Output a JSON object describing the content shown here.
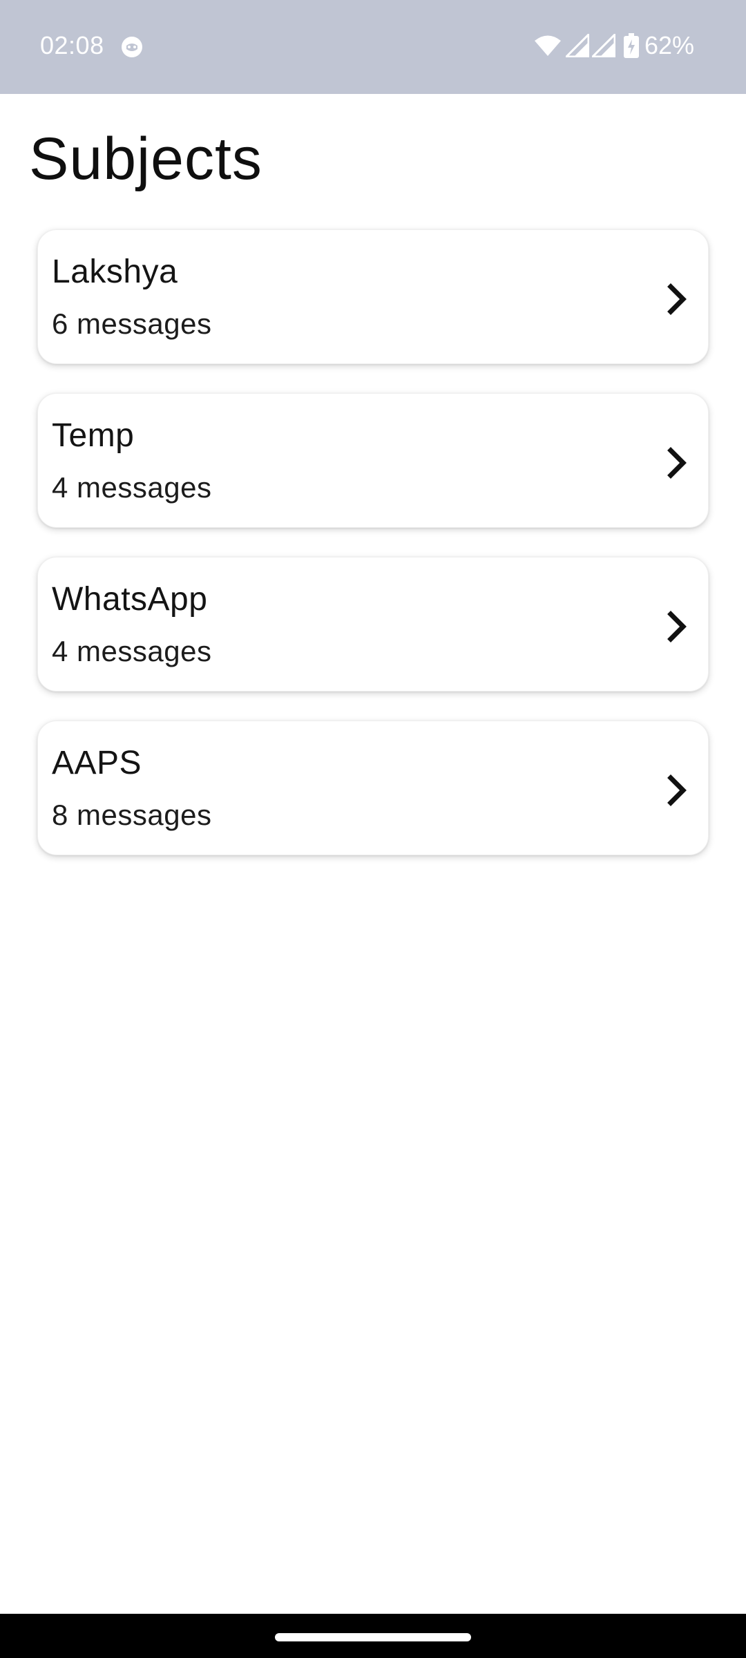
{
  "status_bar": {
    "time": "02:08",
    "battery_percent": "62%",
    "icons": [
      "app-notification-icon",
      "wifi-icon",
      "signal-icon",
      "signal-icon",
      "battery-charging-icon"
    ]
  },
  "page": {
    "title": "Subjects"
  },
  "subjects": [
    {
      "name": "Lakshya",
      "count": "6 messages"
    },
    {
      "name": "Temp",
      "count": "4 messages"
    },
    {
      "name": "WhatsApp",
      "count": "4 messages"
    },
    {
      "name": "AAPS",
      "count": "8 messages"
    }
  ],
  "colors": {
    "status_bar_bg": "#c0c5d3",
    "page_bg": "#ffffff",
    "text": "#111111",
    "nav_bar_bg": "#000000"
  }
}
